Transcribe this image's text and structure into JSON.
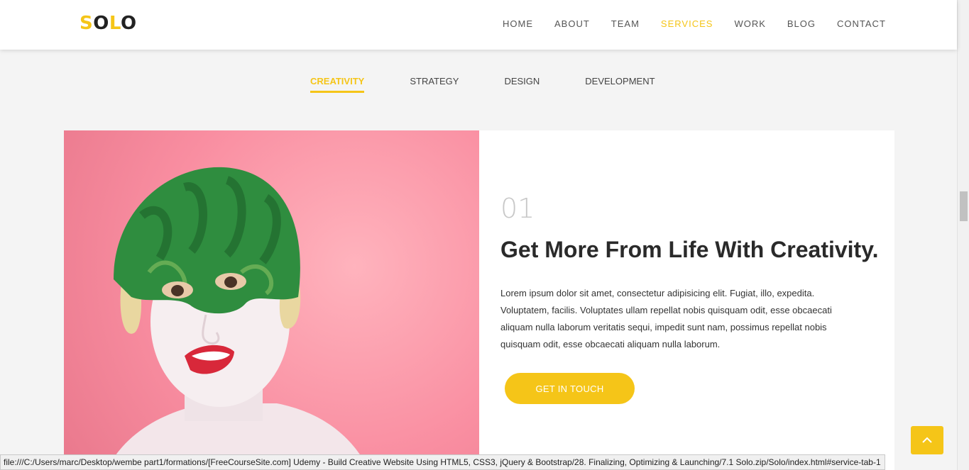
{
  "logo": {
    "first_letter": "S",
    "rest_first": "O",
    "middle": "L",
    "rest_last": "O"
  },
  "nav": {
    "items": [
      "HOME",
      "ABOUT",
      "TEAM",
      "SERVICES",
      "WORK",
      "BLOG",
      "CONTACT"
    ],
    "active": "SERVICES"
  },
  "tabs": {
    "items": [
      "CREATIVITY",
      "STRATEGY",
      "DESIGN",
      "DEVELOPMENT"
    ],
    "active": "CREATIVITY"
  },
  "service": {
    "number": "01",
    "heading": "Get More From Life With Creativity.",
    "paragraph": "Lorem ipsum dolor sit amet, consectetur adipisicing elit. Fugiat, illo, expedita. Voluptatem, facilis. Voluptates ullam repellat nobis quisquam odit, esse obcaecati aliquam nulla laborum veritatis sequi, impedit sunt nam, possimus repellat nobis quisquam odit, esse obcaecati aliquam nulla laborum.",
    "cta_label": "GET IN TOUCH"
  },
  "photo": {
    "subject": "person-with-watermelon-helmet"
  },
  "scroll_top_icon": "chevron-up-icon",
  "status_bar": "file:///C:/Users/marc/Desktop/wembe part1/formations/[FreeCourseSite.com] Udemy - Build Creative Website Using HTML5, CSS3, jQuery & Bootstrap/28. Finalizing,  Optimizing & Launching/7.1 Solo.zip/Solo/index.html#service-tab-1",
  "colors": {
    "accent": "#f5c518",
    "background": "#f4f4f4",
    "photo_bg": "#f98ea1"
  }
}
